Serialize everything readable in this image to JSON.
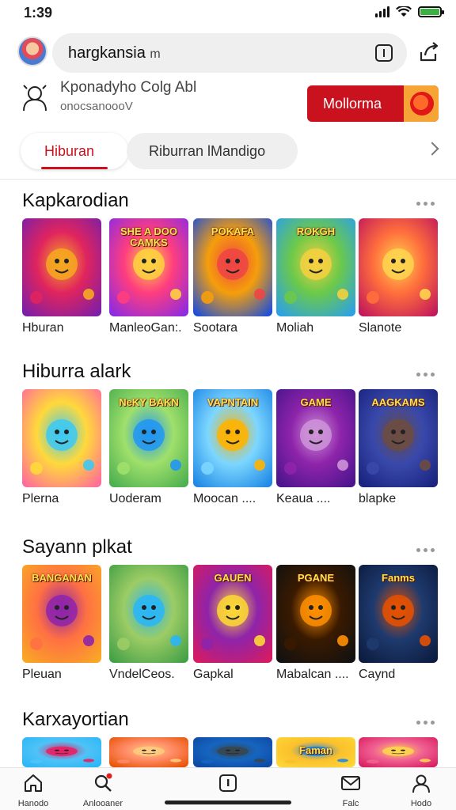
{
  "status_bar": {
    "time": "1:39"
  },
  "search": {
    "query": "hargkansia",
    "suffix": "m"
  },
  "brand": {
    "title": "Kponadyho Colg Abl",
    "subtitle": "onocsanoooV"
  },
  "cta": {
    "label": "Mollorma"
  },
  "tabs": [
    {
      "label": "Hiburan",
      "active": true
    },
    {
      "label": "Riburran lMandigo",
      "active": false
    }
  ],
  "sections": [
    {
      "title": "Kapkarodian",
      "items": [
        {
          "label": "Hburan"
        },
        {
          "label": "ManleoGan:."
        },
        {
          "label": "Sootara"
        },
        {
          "label": "Moliah"
        },
        {
          "label": "Slanote"
        }
      ]
    },
    {
      "title": "Hiburra alark",
      "items": [
        {
          "label": "Plerna"
        },
        {
          "label": "Uoderam"
        },
        {
          "label": "Moocan ...."
        },
        {
          "label": "Keaua ...."
        },
        {
          "label": "blapke"
        }
      ]
    },
    {
      "title": "Sayann plkat",
      "items": [
        {
          "label": "Pleuan"
        },
        {
          "label": "VndelCeos."
        },
        {
          "label": "Gapkal"
        },
        {
          "label": "Mabalcan ...."
        },
        {
          "label": "Caynd"
        }
      ]
    },
    {
      "title": "Karxayortian",
      "items": []
    }
  ],
  "card_art_text": [
    [
      "",
      "SHE A DOO CAMKS",
      "POKAFA",
      "ROKGH",
      ""
    ],
    [
      "",
      "NeKY BAKN",
      "VAPNTAIN",
      "GAME",
      "AAGKAMS"
    ],
    [
      "BANGANAN",
      "",
      "GAUEN",
      "PGANE",
      "Fanms"
    ],
    [
      "",
      "",
      "",
      "Faman",
      ""
    ]
  ],
  "bottom_nav": [
    {
      "label": "Hanodo",
      "icon": "home-icon"
    },
    {
      "label": "Anlooaner",
      "icon": "search-icon"
    },
    {
      "label": "",
      "icon": "square-icon"
    },
    {
      "label": "Falc",
      "icon": "mail-icon"
    },
    {
      "label": "Hodo",
      "icon": "profile-icon"
    }
  ],
  "colors": {
    "accent": "#c9121e",
    "cta_badge": "#f7a437"
  }
}
